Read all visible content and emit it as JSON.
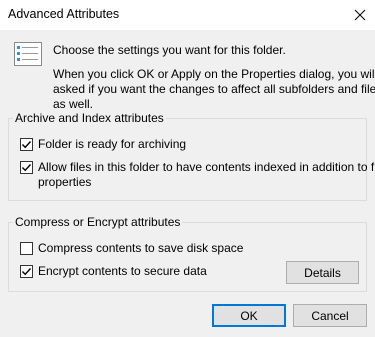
{
  "window": {
    "title": "Advanced Attributes"
  },
  "intro": {
    "line1": "Choose the settings you want for this folder.",
    "line2": "When you click OK or Apply on the Properties dialog, you will be",
    "line3": "asked if you want the changes to affect all subfolders and files",
    "line4": "as well."
  },
  "archive_group": {
    "label": "Archive and Index attributes",
    "items": [
      {
        "label": "Folder is ready for archiving",
        "checked": true
      },
      {
        "label_line1": "Allow files in this folder to have contents indexed in addition to file",
        "label_line2": "properties",
        "checked": true
      }
    ]
  },
  "compress_group": {
    "label": "Compress or Encrypt attributes",
    "items": [
      {
        "label": "Compress contents to save disk space",
        "checked": false
      },
      {
        "label": "Encrypt contents to secure data",
        "checked": true
      }
    ],
    "details_label": "Details"
  },
  "buttons": {
    "ok_label": "OK",
    "cancel_label": "Cancel"
  },
  "colors": {
    "accent": "#0078d7",
    "dialog_bg": "#f0f0f0",
    "button_bg": "#e1e1e1"
  }
}
